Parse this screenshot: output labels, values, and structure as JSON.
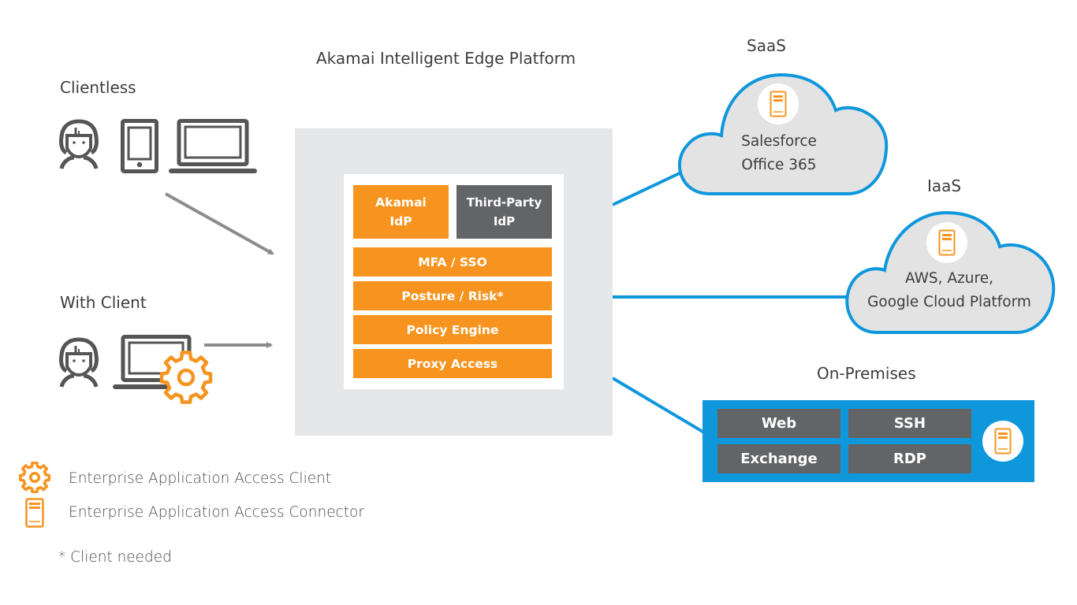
{
  "colors": {
    "orange": "#f6941f",
    "dark_gray": "#636466",
    "blue": "#0f97dc",
    "platform_gray": "#e6e7e8",
    "cloud_fill": "#e3e3e4",
    "icon_gray": "#555555",
    "arrow_gray": "#8c8c8c"
  },
  "left": {
    "clientless": {
      "title": "Clientless",
      "icons": [
        "user-icon",
        "tablet-icon",
        "laptop-icon"
      ]
    },
    "with_client": {
      "title": "With Client",
      "icons": [
        "user-icon",
        "laptop-icon",
        "gear-icon"
      ]
    }
  },
  "platform": {
    "title": "Akamai Intelligent Edge Platform",
    "idp": [
      {
        "line1": "Akamai",
        "line2": "IdP",
        "color": "orange"
      },
      {
        "line1": "Third-Party",
        "line2": "IdP",
        "color": "dark_gray"
      }
    ],
    "layers": [
      "MFA / SSO",
      "Posture / Risk*",
      "Policy Engine",
      "Proxy Access"
    ]
  },
  "destinations": {
    "saas": {
      "title": "SaaS",
      "lines": [
        "Salesforce",
        "Office 365"
      ],
      "icon": "connector-icon"
    },
    "iaas": {
      "title": "IaaS",
      "lines": [
        "AWS, Azure,",
        "Google Cloud Platform"
      ],
      "icon": "connector-icon"
    },
    "onprem": {
      "title": "On-Premises",
      "apps": [
        "Web",
        "SSH",
        "Exchange",
        "RDP"
      ],
      "icon": "connector-icon"
    }
  },
  "legend": {
    "items": [
      {
        "icon": "gear-icon",
        "label": "Enterprise Application Access Client"
      },
      {
        "icon": "connector-icon",
        "label": "Enterprise Application Access Connector"
      }
    ],
    "footnote": "* Client needed"
  }
}
